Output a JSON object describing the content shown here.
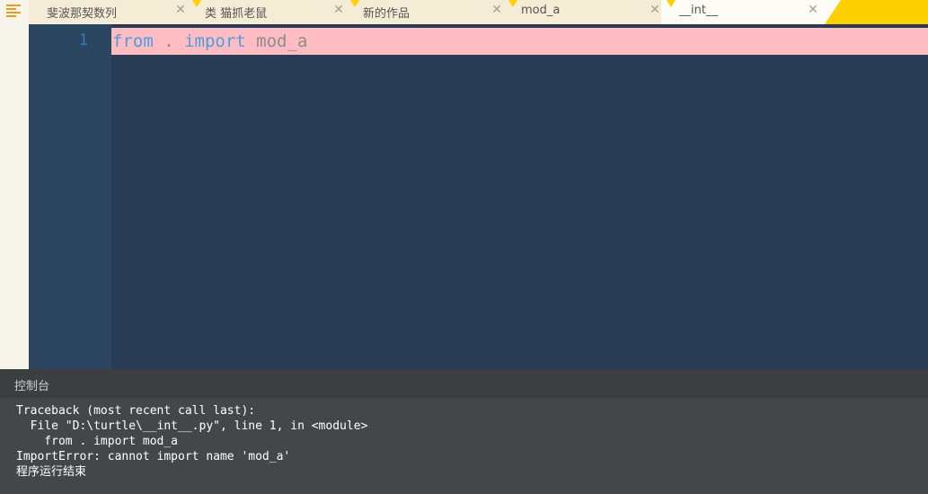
{
  "tabs": [
    {
      "label": "斐波那契数列",
      "close": "✕",
      "active": false
    },
    {
      "label": "类 猫抓老鼠",
      "close": "✕",
      "active": false
    },
    {
      "label": "新的作品",
      "close": "✕",
      "active": false
    },
    {
      "label": "mod_a",
      "close": "✕",
      "active": false
    },
    {
      "label": "__int__",
      "close": "✕",
      "active": true
    }
  ],
  "editor": {
    "line_number": "1",
    "code": {
      "kw_from": "from",
      "dot": " . ",
      "kw_import": "import",
      "module": " mod_a"
    }
  },
  "console": {
    "title": "控制台",
    "lines": [
      "Traceback (most recent call last):",
      "  File \"D:\\turtle\\__int__.py\", line 1, in <module>",
      "    from . import mod_a",
      "ImportError: cannot import name 'mod_a'",
      "程序运行结束"
    ]
  },
  "icons": {
    "menu": "menu-lines-icon",
    "close": "close-icon"
  },
  "colors": {
    "tab_bar_accent": "#ffd000",
    "editor_bg": "#283d55",
    "error_line_highlight": "#ffbcc3",
    "keyword": "#4a9fe0",
    "console_bg": "#444649"
  }
}
